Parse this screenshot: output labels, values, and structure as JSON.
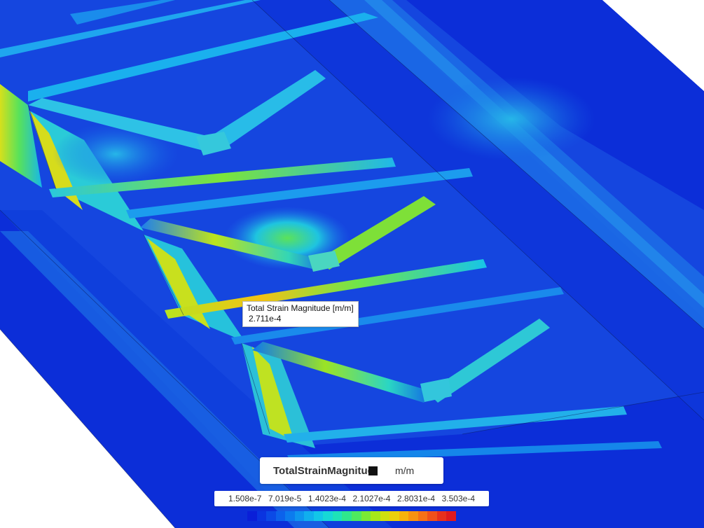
{
  "probe": {
    "label": "Total Strain Magnitude [m/m]",
    "value": "2.711e-4"
  },
  "legend": {
    "field_name": "TotalStrainMagnitude",
    "units": "m/m",
    "ticks": [
      "1.508e-7",
      "7.019e-5",
      "1.4023e-4",
      "2.1027e-4",
      "2.8031e-4",
      "3.503e-4"
    ],
    "colors": [
      "#0a1fd8",
      "#0a34e0",
      "#0b4ae6",
      "#0c62eb",
      "#0c7bee",
      "#0e95ef",
      "#10afee",
      "#12c6e8",
      "#16d8d6",
      "#1ee3b8",
      "#2fe78c",
      "#4eea5e",
      "#7aea34",
      "#a6e81a",
      "#cfe010",
      "#ebcf0c",
      "#f6b20c",
      "#f89210",
      "#f67116",
      "#f0501a",
      "#e8301c",
      "#e01a1e"
    ],
    "level_fraction_probe": 0.774
  },
  "model_colors": {
    "background": "#0a2bd6",
    "low": "#1446e0",
    "mid": "#1fa8ef",
    "mid_high": "#2fd8c2",
    "high": "#d4e21a",
    "peak": "#f2c012"
  }
}
